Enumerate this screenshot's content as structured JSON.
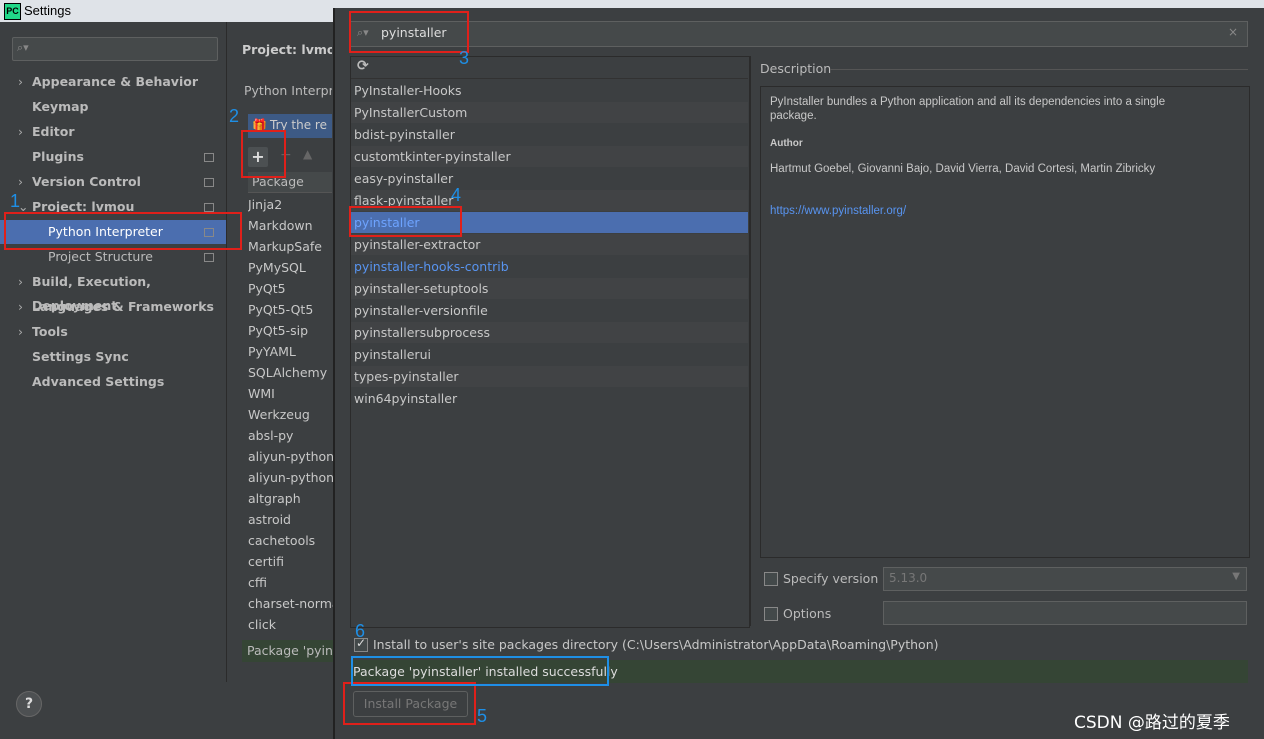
{
  "settings": {
    "window_title": "Settings",
    "logo_text": "PC",
    "page_title": "Project: lvmou",
    "interpreter_label": "Python Interpre",
    "try_hint": "Try the re",
    "package_header": "Package",
    "status_snippet": "Package 'pyins",
    "help_label": "?",
    "tree": [
      {
        "label": "Appearance & Behavior",
        "chevron": "›",
        "mark": false
      },
      {
        "label": "Keymap",
        "chevron": "",
        "mark": false
      },
      {
        "label": "Editor",
        "chevron": "›",
        "mark": false
      },
      {
        "label": "Plugins",
        "chevron": "",
        "mark": true
      },
      {
        "label": "Version Control",
        "chevron": "›",
        "mark": true
      },
      {
        "label": "Project: lvmou",
        "chevron": "⌄",
        "mark": true
      },
      {
        "label": "Python Interpreter",
        "chevron": "",
        "mark": true
      },
      {
        "label": "Project Structure",
        "chevron": "",
        "mark": true
      },
      {
        "label": "Build, Execution, Deployment",
        "chevron": "›",
        "mark": false
      },
      {
        "label": "Languages & Frameworks",
        "chevron": "›",
        "mark": false
      },
      {
        "label": "Tools",
        "chevron": "›",
        "mark": false
      },
      {
        "label": "Settings Sync",
        "chevron": "",
        "mark": false
      },
      {
        "label": "Advanced Settings",
        "chevron": "",
        "mark": false
      }
    ],
    "packages": [
      "Jinja2",
      "Markdown",
      "MarkupSafe",
      "PyMySQL",
      "PyQt5",
      "PyQt5-Qt5",
      "PyQt5-sip",
      "PyYAML",
      "SQLAlchemy",
      "WMI",
      "Werkzeug",
      "absl-py",
      "aliyun-python-",
      "aliyun-python-",
      "altgraph",
      "astroid",
      "cachetools",
      "certifi",
      "cffi",
      "charset-norma",
      "click"
    ]
  },
  "dialog": {
    "search_value": "pyinstaller",
    "clear_icon": "×",
    "refresh_icon": "⟳",
    "results": [
      {
        "name": "PyInstaller-Hooks",
        "style": "normal"
      },
      {
        "name": "PyInstallerCustom",
        "style": "normal"
      },
      {
        "name": "bdist-pyinstaller",
        "style": "normal"
      },
      {
        "name": "customtkinter-pyinstaller",
        "style": "normal"
      },
      {
        "name": "easy-pyinstaller",
        "style": "normal"
      },
      {
        "name": "flask-pyinstaller",
        "style": "normal"
      },
      {
        "name": "pyinstaller",
        "style": "selected"
      },
      {
        "name": "pyinstaller-extractor",
        "style": "normal"
      },
      {
        "name": "pyinstaller-hooks-contrib",
        "style": "link"
      },
      {
        "name": "pyinstaller-setuptools",
        "style": "normal"
      },
      {
        "name": "pyinstaller-versionfile",
        "style": "normal"
      },
      {
        "name": "pyinstallersubprocess",
        "style": "normal"
      },
      {
        "name": "pyinstallerui",
        "style": "normal"
      },
      {
        "name": "types-pyinstaller",
        "style": "normal"
      },
      {
        "name": "win64pyinstaller",
        "style": "normal"
      }
    ],
    "description": {
      "heading": "Description",
      "text_line1": "PyInstaller bundles a Python application and all its dependencies into a single",
      "text_line2": "package.",
      "author_label": "Author",
      "authors": "Hartmut Goebel, Giovanni Bajo, David Vierra, David Cortesi, Martin Zibricky",
      "url": "https://www.pyinstaller.org/"
    },
    "specify_version_label": "Specify version",
    "version_value": "5.13.0",
    "options_label": "Options",
    "install_to_user_label": "Install to user's site packages directory (C:\\Users\\Administrator\\AppData\\Roaming\\Python)",
    "status_message": "Package 'pyinstaller' installed successfully",
    "install_button": "Install Package"
  },
  "annotations": {
    "n1": "1",
    "n2": "2",
    "n3": "3",
    "n4": "4",
    "n5": "5",
    "n6": "6",
    "red_color": "#e0201a",
    "blue_color": "#1e8fe6"
  },
  "watermark": "CSDN @路过的夏季"
}
